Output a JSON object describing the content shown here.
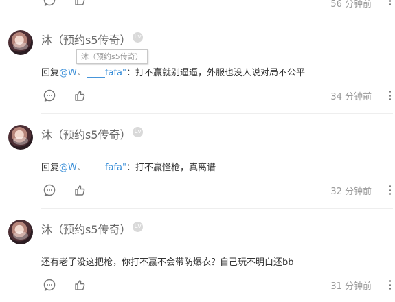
{
  "top_partial": {
    "time": "56 分钟前"
  },
  "tooltip": "沐（预约s5传奇）",
  "comments": [
    {
      "username": "沐（预约s5传奇）",
      "level_badge": "Lv",
      "reply_prefix": "回复",
      "mentions": [
        "@W",
        "____fafa"
      ],
      "mention_separator": "、",
      "mention_end": "\"",
      "colon": "：",
      "text": "打不赢就别逼逼，外服也没人说对局不公平",
      "time": "34 分钟前"
    },
    {
      "username": "沐（预约s5传奇）",
      "level_badge": "Lv",
      "reply_prefix": "回复",
      "mentions": [
        "@W",
        "____fafa"
      ],
      "mention_separator": "、",
      "mention_end": "\"",
      "colon": "：",
      "text": "打不赢怪枪，真离谱",
      "time": "32 分钟前"
    },
    {
      "username": "沐（预约s5传奇）",
      "level_badge": "Lv",
      "text": "还有老子没这把枪，你打不赢不会带防爆衣？自己玩不明白还bb",
      "time": "31 分钟前"
    }
  ],
  "icons": {
    "reply": "comment-bubble-icon",
    "like": "thumbs-up-icon",
    "more": "more-vertical-icon"
  }
}
